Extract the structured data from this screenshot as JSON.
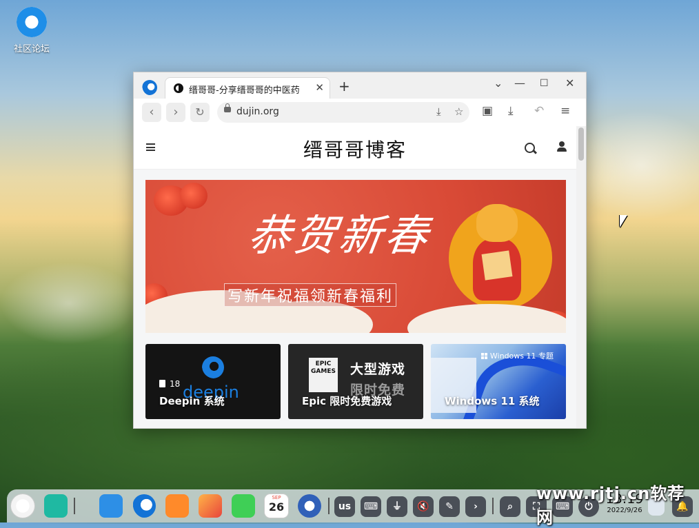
{
  "desktop": {
    "icon_label": "社区论坛"
  },
  "browser": {
    "tab_title": "缙哥哥-分享缙哥哥的中医药",
    "tab_close": "✕",
    "new_tab": "+",
    "window_buttons": {
      "dropdown": "⌄",
      "minimize": "—",
      "maximize": "☐",
      "close": "✕"
    },
    "back": "‹",
    "forward": "›",
    "reload": "↻",
    "url": "dujin.org",
    "icons": [
      "download-page-icon",
      "star-icon",
      "collections-icon",
      "download-icon",
      "undo-icon",
      "menu-icon"
    ]
  },
  "site": {
    "brand": "缙哥哥博客",
    "banner": {
      "calligraphy": "恭贺新春",
      "slogan": "写新年祝福领新春福利"
    },
    "cards": [
      {
        "title": "Deepin 系统",
        "count": "18",
        "logo_text": "deepin"
      },
      {
        "title": "Epic 限时免费游戏",
        "logo_text": "EPIC GAMES",
        "big_line1": "大型游戏",
        "big_line2": "限时免费"
      },
      {
        "title": "Windows 11 系统",
        "tag": "Windows 11 专题"
      }
    ]
  },
  "taskbar": {
    "indicators": {
      "keyboard_layout": "us"
    },
    "calendar_day": "26",
    "calendar_month": "SEP",
    "time": "13:19",
    "date": "2022/9/26"
  },
  "watermark": "www.rjtj.cn软荐网",
  "colors": {
    "banner_red": "#d94a36",
    "deepin_blue": "#1b7fe0",
    "dock_bg": "#e2e8f0"
  }
}
